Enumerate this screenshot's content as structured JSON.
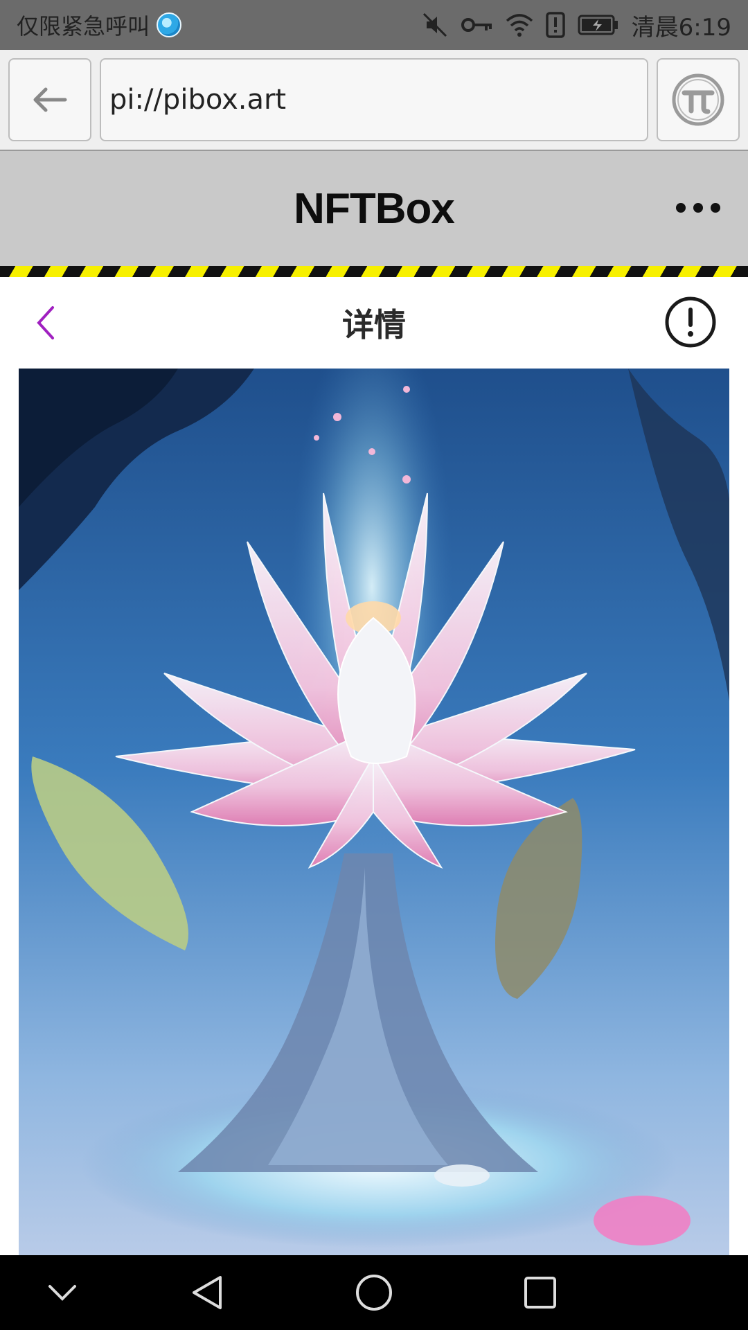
{
  "status_bar": {
    "carrier_text": "仅限紧急呼叫",
    "time": "清晨6:19",
    "icons": [
      "mute-icon",
      "vpn-key-icon",
      "wifi-icon",
      "alert-icon",
      "battery-icon"
    ]
  },
  "browser": {
    "url": "pi://pibox.art",
    "back_icon": "arrow-left-icon",
    "pi_icon": "pi-logo-icon"
  },
  "app_header": {
    "title": "NFTBox",
    "more_icon": "more-dots-icon"
  },
  "page": {
    "title": "详情",
    "back_icon": "chevron-left-icon",
    "info_icon": "info-circle-icon"
  },
  "artwork": {
    "subject": "lotus-painting"
  },
  "system_nav": {
    "icons": [
      "collapse-icon",
      "back-triangle-icon",
      "home-circle-icon",
      "recents-square-icon"
    ]
  },
  "colors": {
    "status_bg": "#6b6b6b",
    "header_bg": "#c9c9c9",
    "accent_purple": "#a020c0",
    "stripe_yellow": "#f7f000"
  }
}
